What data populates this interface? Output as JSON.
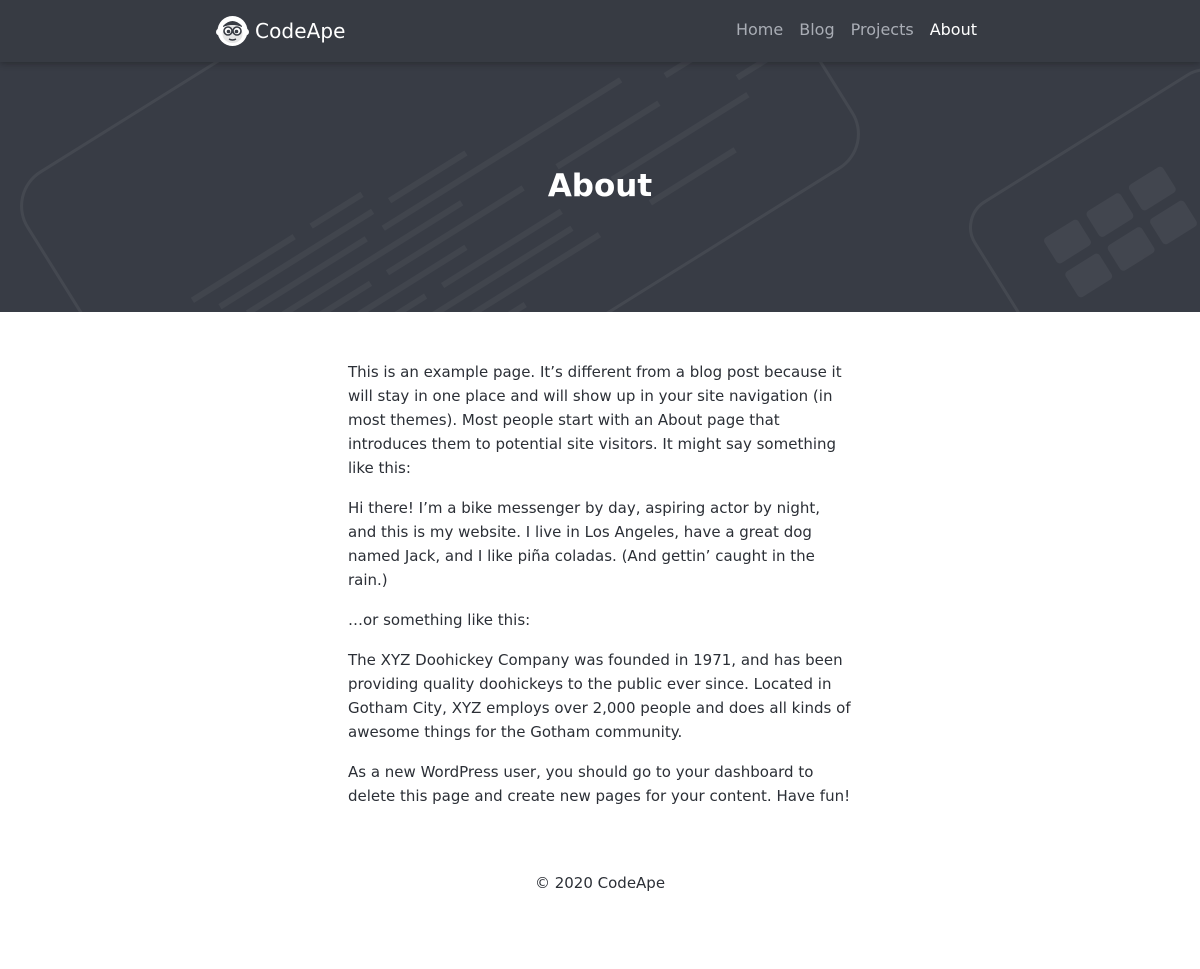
{
  "site": {
    "brand_name": "CodeApe",
    "logo_icon": "monkey-logo-icon"
  },
  "nav": {
    "items": [
      {
        "label": "Home",
        "active": false
      },
      {
        "label": "Blog",
        "active": false
      },
      {
        "label": "Projects",
        "active": false
      },
      {
        "label": "About",
        "active": true
      }
    ]
  },
  "hero": {
    "title": "About"
  },
  "content": {
    "paragraphs": [
      "This is an example page. It’s different from a blog post because it will stay in one place and will show up in your site navigation (in most themes). Most people start with an About page that introduces them to potential site visitors. It might say something like this:",
      "Hi there! I’m a bike messenger by day, aspiring actor by night, and this is my website. I live in Los Angeles, have a great dog named Jack, and I like piña coladas. (And gettin’ caught in the rain.)",
      "…or something like this:",
      "The XYZ Doohickey Company was founded in 1971, and has been providing quality doohickeys to the public ever since. Located in Gotham City, XYZ employs over 2,000 people and does all kinds of awesome things for the Gotham community.",
      "As a new WordPress user, you should go to your dashboard to delete this page and create new pages for your content. Have fun!"
    ]
  },
  "footer": {
    "text": "© 2020 CodeApe"
  },
  "colors": {
    "hero_bg": "#383c45",
    "navbar_bg": "#373b43",
    "nav_inactive": "#a9adb5",
    "nav_active": "#ffffff",
    "body_text": "#2b2f36"
  }
}
